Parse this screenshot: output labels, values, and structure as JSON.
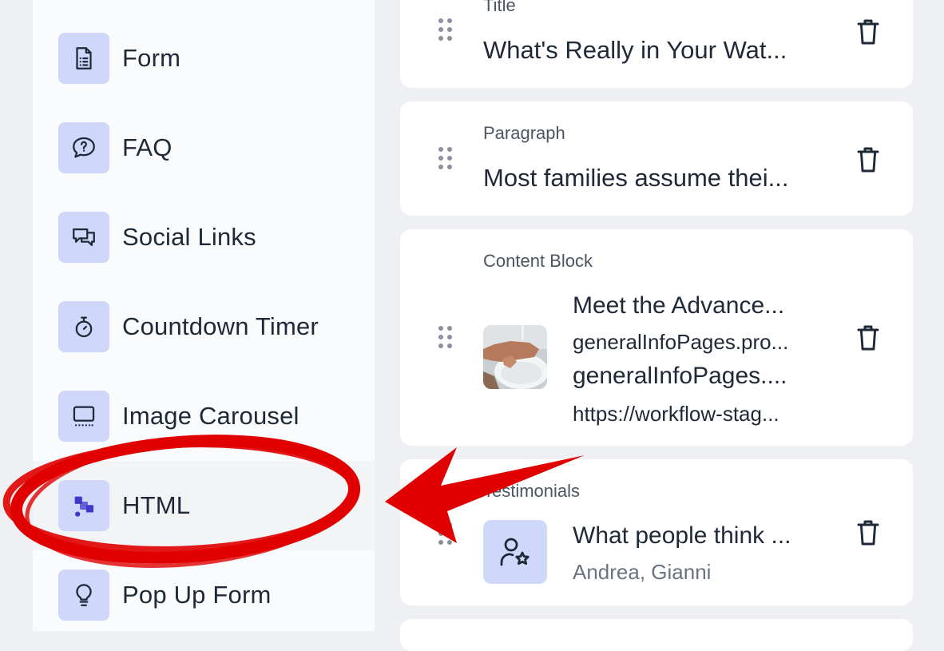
{
  "sidebar": {
    "items": [
      {
        "label": "Form",
        "icon": "form-icon"
      },
      {
        "label": "FAQ",
        "icon": "faq-icon"
      },
      {
        "label": "Social Links",
        "icon": "social-links-icon"
      },
      {
        "label": "Countdown Timer",
        "icon": "timer-icon"
      },
      {
        "label": "Image Carousel",
        "icon": "carousel-icon"
      },
      {
        "label": "HTML",
        "icon": "html-icon"
      },
      {
        "label": "Pop Up Form",
        "icon": "lightbulb-icon"
      }
    ]
  },
  "blocks": [
    {
      "type_label": "Title",
      "text": "What's Really in Your Wat..."
    },
    {
      "type_label": "Paragraph",
      "text": "Most families assume thei..."
    },
    {
      "type_label": "Content Block",
      "line1": "Meet the Advance...",
      "line2": "generalInfoPages.pro...",
      "line3": "generalInfoPages....",
      "line4": "https://workflow-stag..."
    },
    {
      "type_label": "Testimonials",
      "text": "What people think ...",
      "sub": "Andrea, Gianni"
    }
  ],
  "colors": {
    "page_bg": "#eef0f3",
    "icon_bg": "#cfd8fb",
    "accent": "#4338ca",
    "annotation": "#e00000"
  }
}
